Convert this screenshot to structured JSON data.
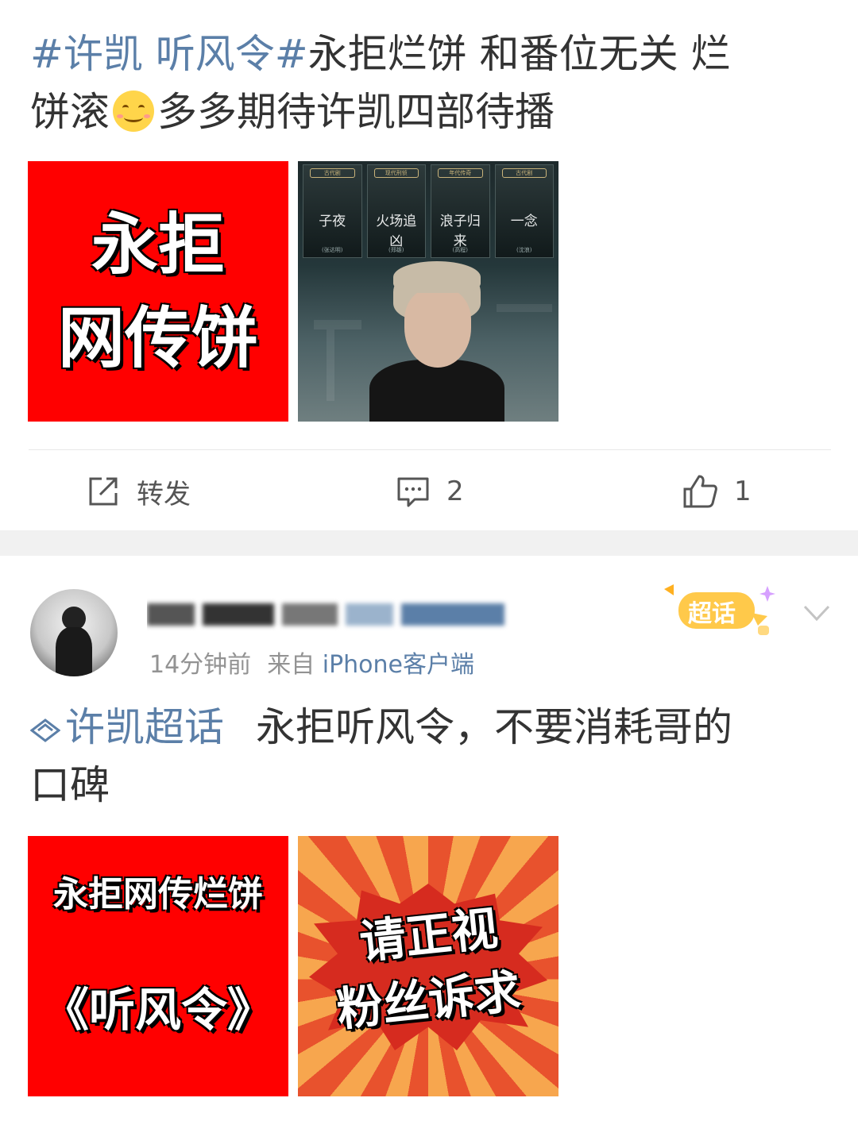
{
  "post1": {
    "hashtag": "#许凯 听风令#",
    "text_line1_rest": "永拒烂饼 和番位无关 烂",
    "text_line2_a": "饼滚",
    "emoji": "smiling-face-emoji",
    "text_line2_b": "多多期待许凯四部待播",
    "image1": {
      "line1": "永拒",
      "line2": "网传饼"
    },
    "image2": {
      "posters": [
        {
          "tag": "古代剧",
          "title": "子夜",
          "sub": "(张达明)"
        },
        {
          "tag": "现代刑侦",
          "title": "火场追凶",
          "sub": "(郑雄)"
        },
        {
          "tag": "年代传奇",
          "title": "浪子归来",
          "sub": "(高程)"
        },
        {
          "tag": "古代剧",
          "title": "一念",
          "sub": "(沈浪)"
        }
      ]
    },
    "actions": {
      "repost": "转发",
      "comments": "2",
      "likes": "1"
    }
  },
  "post2": {
    "meta": {
      "time": "14分钟前",
      "source_prefix": "来自",
      "device": "iPhone客户端"
    },
    "badge": "超话",
    "topic": "许凯超话",
    "text_line1": "永拒听风令，不要消耗哥的",
    "text_line2": "口碑",
    "image1": {
      "line1": "永拒网传烂饼",
      "line2": "《听风令》"
    },
    "image2": {
      "line1": "请正视",
      "line2": "粉丝诉求"
    }
  },
  "colors": {
    "hashtag": "#5b7fa8",
    "red_card": "#ff0000",
    "meta": "#939393"
  }
}
